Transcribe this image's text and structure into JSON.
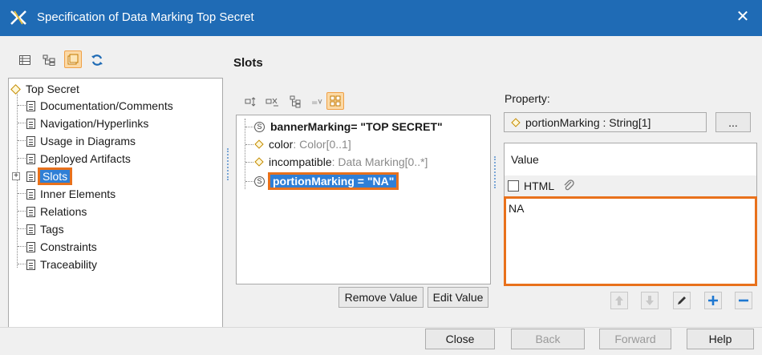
{
  "window": {
    "title": "Specification of Data Marking Top Secret"
  },
  "toolbar_icons": [
    "list-view-icon",
    "tree-view-icon",
    "compartment-icon",
    "refresh-icon"
  ],
  "tree": {
    "root": "Top Secret",
    "items": [
      "Documentation/Comments",
      "Navigation/Hyperlinks",
      "Usage in Diagrams",
      "Deployed Artifacts",
      "Slots",
      "Inner Elements",
      "Relations",
      "Tags",
      "Constraints",
      "Traceability"
    ]
  },
  "section": {
    "title": "Slots"
  },
  "slots": [
    {
      "name": "bannerMarking",
      "suffix": " = \"TOP SECRET\"",
      "style": "bold"
    },
    {
      "name": "color",
      "suffix": " : Color[0..1]",
      "style": "normal"
    },
    {
      "name": "incompatible",
      "suffix": " : Data Marking[0..*]",
      "style": "normal"
    },
    {
      "name": "portionMarking",
      "suffix": " = \"NA\"",
      "style": "selected"
    }
  ],
  "slot_buttons": {
    "remove": "Remove Value",
    "edit": "Edit Value"
  },
  "property": {
    "label": "Property:",
    "value": "portionMarking : String[1]",
    "ellipsis": "..."
  },
  "value_panel": {
    "header": "Value",
    "html_label": "HTML",
    "text": "NA"
  },
  "footer": {
    "close": "Close",
    "back": "Back",
    "forward": "Forward",
    "help": "Help"
  },
  "colors": {
    "titlebar": "#1f6bb5",
    "highlight": "#e8711c",
    "selection": "#2f7fd6"
  }
}
